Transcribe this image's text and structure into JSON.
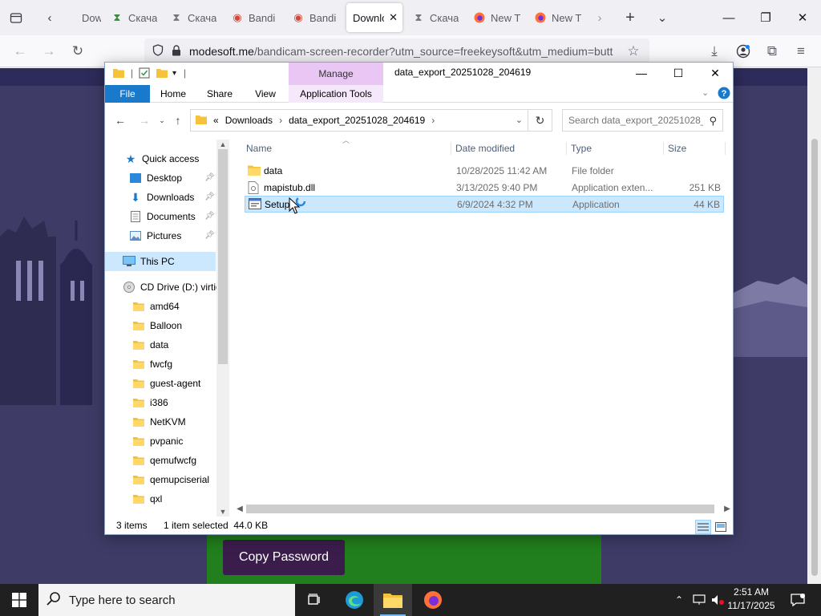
{
  "browser": {
    "tabs": [
      {
        "label": "Down",
        "icon": "download-icon"
      },
      {
        "label": "Скача",
        "icon": "torrent-icon"
      },
      {
        "label": "Скача",
        "icon": "torrent-icon"
      },
      {
        "label": "Bandi",
        "icon": "bandicam-icon"
      },
      {
        "label": "Bandi",
        "icon": "bandicam-icon"
      },
      {
        "label": "Downlo",
        "icon": "",
        "active": true
      },
      {
        "label": "Скача",
        "icon": "torrent-icon"
      },
      {
        "label": "New T",
        "icon": "firefox-icon"
      },
      {
        "label": "New T",
        "icon": "firefox-icon"
      }
    ],
    "url_domain": "modesoft.me",
    "url_path": "/bandicam-screen-recorder?utm_source=freekeysoft&utm_medium=butt"
  },
  "page": {
    "copy_button_label": "Copy Password",
    "colors": {
      "bg": "#3e3c67",
      "green": "#217f1d",
      "button": "#3b1d4c"
    }
  },
  "explorer": {
    "title": "data_export_20251028_204619",
    "manage_label": "Manage",
    "ribbon_tabs": {
      "file": "File",
      "home": "Home",
      "share": "Share",
      "view": "View",
      "app_tools": "Application Tools"
    },
    "address": {
      "overflow": "«",
      "segments": [
        "Downloads",
        "data_export_20251028_204619"
      ]
    },
    "search_placeholder": "Search data_export_20251028_...",
    "nav": {
      "quick_access": "Quick access",
      "desktop": "Desktop",
      "downloads": "Downloads",
      "documents": "Documents",
      "pictures": "Pictures",
      "this_pc": "This PC",
      "cd_drive": "CD Drive (D:) virtio",
      "folders": [
        "amd64",
        "Balloon",
        "data",
        "fwcfg",
        "guest-agent",
        "i386",
        "NetKVM",
        "pvpanic",
        "qemufwcfg",
        "qemupciserial",
        "qxl"
      ]
    },
    "columns": {
      "name": "Name",
      "date": "Date modified",
      "type": "Type",
      "size": "Size"
    },
    "files": [
      {
        "name": "data",
        "date": "10/28/2025 11:42 AM",
        "type": "File folder",
        "size": "",
        "icon": "folder-icon"
      },
      {
        "name": "mapistub.dll",
        "date": "3/13/2025 9:40 PM",
        "type": "Application exten...",
        "size": "251 KB",
        "icon": "dll-file-icon"
      },
      {
        "name": "Setup",
        "date": "6/9/2024 4:32 PM",
        "type": "Application",
        "size": "44 KB",
        "icon": "application-icon",
        "selected": true
      }
    ],
    "status": {
      "count": "3 items",
      "selected": "1 item selected  44.0 KB"
    }
  },
  "taskbar": {
    "search_placeholder": "Type here to search",
    "time": "2:51 AM",
    "date": "11/17/2025"
  }
}
